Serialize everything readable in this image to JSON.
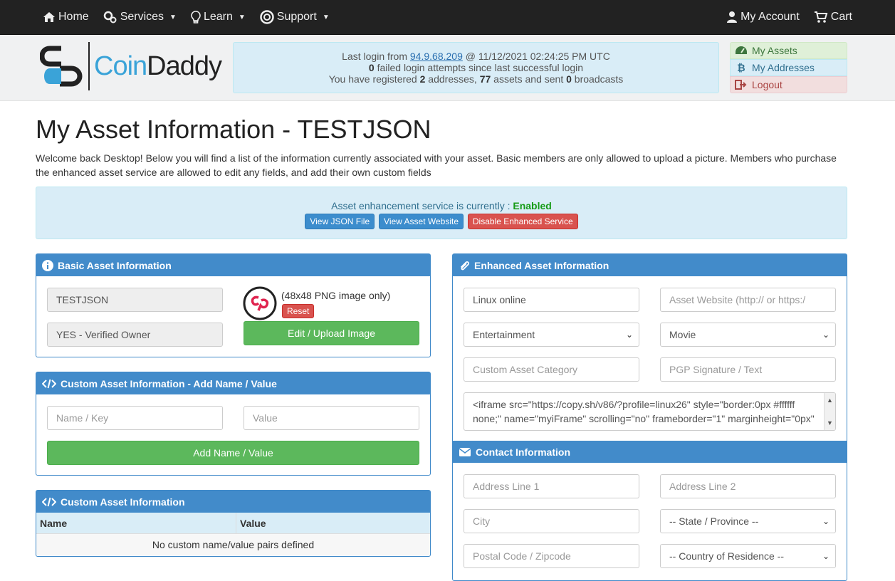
{
  "nav": {
    "home": "Home",
    "services": "Services",
    "learn": "Learn",
    "support": "Support",
    "my_account": "My Account",
    "cart": "Cart"
  },
  "brand": {
    "coin": "Coin",
    "daddy": "Daddy"
  },
  "login_box": {
    "line1_prefix": "Last login from ",
    "ip": "94.9.68.209",
    "line1_suffix": " @ 11/12/2021 02:24:25 PM UTC",
    "failed_count": "0",
    "line2_suffix": " failed login attempts since last successful login",
    "line3_a": "You have registered ",
    "addresses": "2",
    "line3_b": " addresses, ",
    "assets": "77",
    "line3_c": " assets and sent ",
    "broadcasts": "0",
    "line3_d": " broadcasts"
  },
  "account_menu": {
    "assets": "My Assets",
    "addresses": "My Addresses",
    "logout": "Logout"
  },
  "page": {
    "title": "My Asset Information - TESTJSON",
    "intro": "Welcome back Desktop! Below you will find a list of the information currently associated with your asset. Basic members are only allowed to upload a picture. Members who purchase the enhanced asset service are allowed to edit any fields, and add their own custom fields"
  },
  "status": {
    "label": "Asset enhancement service is currently : ",
    "value": "Enabled",
    "btn_json": "View JSON File",
    "btn_website": "View Asset Website",
    "btn_disable": "Disable Enhanced Service"
  },
  "basic": {
    "title": "Basic Asset Information",
    "asset_name": "TESTJSON",
    "owner": "YES - Verified Owner",
    "image_note": "(48x48 PNG image only)",
    "reset": "Reset",
    "upload": "Edit / Upload Image"
  },
  "custom_add": {
    "title": "Custom Asset Information - Add Name / Value",
    "name_placeholder": "Name / Key",
    "value_placeholder": "Value",
    "add_button": "Add Name / Value"
  },
  "custom_list": {
    "title": "Custom Asset Information",
    "col_name": "Name",
    "col_value": "Value",
    "empty": "No custom name/value pairs defined"
  },
  "enhanced": {
    "title": "Enhanced Asset Information",
    "name_value": "Linux online",
    "website_placeholder": "Asset Website (http:// or https:/",
    "category1": "Entertainment",
    "category2": "Movie",
    "custom_category_placeholder": "Custom Asset Category",
    "pgp_placeholder": "PGP Signature / Text",
    "description_line1": "<iframe src=\"https://copy.sh/v86/?profile=linux26\" style=\"border:0px #ffffff",
    "description_line2": "none;\" name=\"myiFrame\" scrolling=\"no\" frameborder=\"1\" marginheight=\"0px\""
  },
  "contact": {
    "title": "Contact Information",
    "address1": "Address Line 1",
    "address2": "Address Line 2",
    "city": "City",
    "state": "-- State / Province --",
    "postal": "Postal Code / Zipcode",
    "country": "-- Country of Residence --"
  }
}
